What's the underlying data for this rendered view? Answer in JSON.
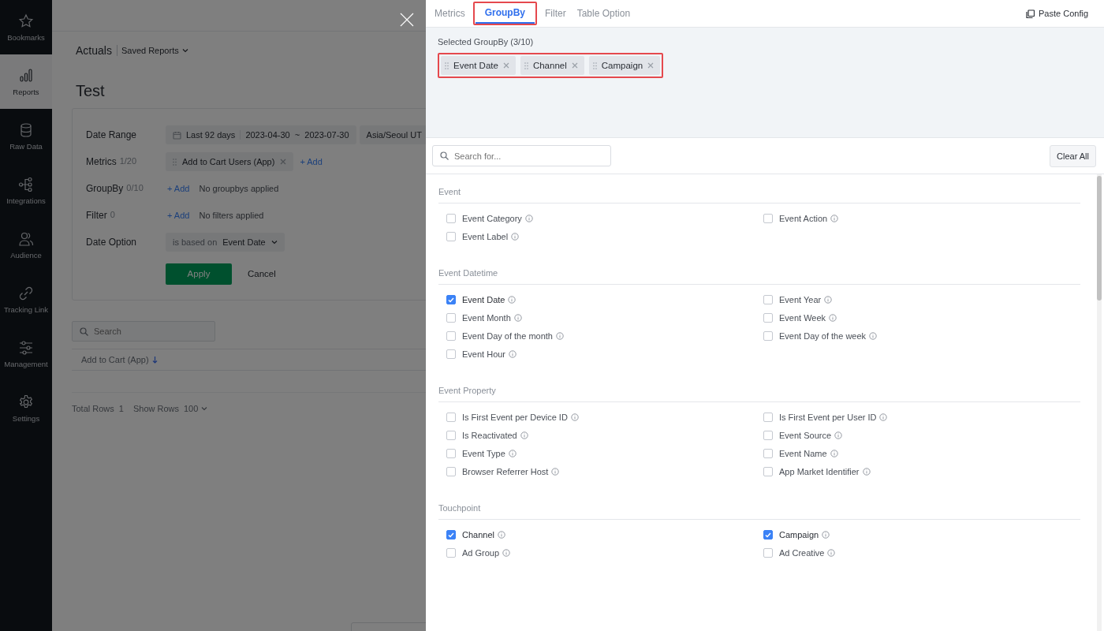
{
  "sidebar": {
    "items": [
      {
        "label": "Bookmarks",
        "selected": false
      },
      {
        "label": "Reports",
        "selected": true
      },
      {
        "label": "Raw Data",
        "selected": false
      },
      {
        "label": "Integrations",
        "selected": false
      },
      {
        "label": "Audience",
        "selected": false
      },
      {
        "label": "Tracking Link",
        "selected": false
      },
      {
        "label": "Management",
        "selected": false
      },
      {
        "label": "Settings",
        "selected": false
      }
    ]
  },
  "header": {
    "title": "Actuals",
    "saved_reports": "Saved Reports"
  },
  "report": {
    "title": "Test",
    "date_range": {
      "label": "Date Range",
      "preset": "Last 92 days",
      "start": "2023-04-30",
      "separator": "~",
      "end": "2023-07-30",
      "timezone": "Asia/Seoul UT"
    },
    "metrics": {
      "label": "Metrics",
      "count": "1/20",
      "chips": [
        "Add to Cart Users (App)"
      ],
      "add": "+ Add"
    },
    "groupby": {
      "label": "GroupBy",
      "count": "0/10",
      "add": "+ Add",
      "empty": "No groupbys applied"
    },
    "filter": {
      "label": "Filter",
      "count": "0",
      "add": "+ Add",
      "empty": "No filters applied"
    },
    "date_option": {
      "label": "Date Option",
      "prefix": "is based on",
      "value": "Event Date"
    },
    "apply": "Apply",
    "cancel": "Cancel"
  },
  "table": {
    "search_placeholder": "Search",
    "columns": [
      "Add to Cart (App)"
    ],
    "total_rows_label": "Total Rows",
    "total_rows": "1",
    "show_rows_label": "Show Rows",
    "show_rows": "100"
  },
  "drawer": {
    "tabs": [
      {
        "label": "Metrics",
        "selected": false
      },
      {
        "label": "GroupBy",
        "selected": true
      },
      {
        "label": "Filter",
        "selected": false
      },
      {
        "label": "Table Option",
        "selected": false
      }
    ],
    "paste_config": "Paste Config",
    "selected_title": "Selected GroupBy (3/10)",
    "selected_chips": [
      "Event Date",
      "Channel",
      "Campaign"
    ],
    "search_placeholder": "Search for...",
    "clear_all": "Clear All",
    "sections": [
      {
        "title": "Event",
        "options": [
          {
            "label": "Event Category",
            "checked": false
          },
          {
            "label": "Event Action",
            "checked": false
          },
          {
            "label": "Event Label",
            "checked": false
          }
        ]
      },
      {
        "title": "Event Datetime",
        "options": [
          {
            "label": "Event Date",
            "checked": true
          },
          {
            "label": "Event Year",
            "checked": false
          },
          {
            "label": "Event Month",
            "checked": false
          },
          {
            "label": "Event Week",
            "checked": false
          },
          {
            "label": "Event Day of the month",
            "checked": false
          },
          {
            "label": "Event Day of the week",
            "checked": false
          },
          {
            "label": "Event Hour",
            "checked": false
          }
        ]
      },
      {
        "title": "Event Property",
        "options": [
          {
            "label": "Is First Event per Device ID",
            "checked": false
          },
          {
            "label": "Is First Event per User ID",
            "checked": false
          },
          {
            "label": "Is Reactivated",
            "checked": false
          },
          {
            "label": "Event Source",
            "checked": false
          },
          {
            "label": "Event Type",
            "checked": false
          },
          {
            "label": "Event Name",
            "checked": false
          },
          {
            "label": "Browser Referrer Host",
            "checked": false
          },
          {
            "label": "App Market Identifier",
            "checked": false
          }
        ]
      },
      {
        "title": "Touchpoint",
        "options": [
          {
            "label": "Channel",
            "checked": true
          },
          {
            "label": "Campaign",
            "checked": true
          },
          {
            "label": "Ad Group",
            "checked": false
          },
          {
            "label": "Ad Creative",
            "checked": false
          }
        ]
      }
    ]
  }
}
